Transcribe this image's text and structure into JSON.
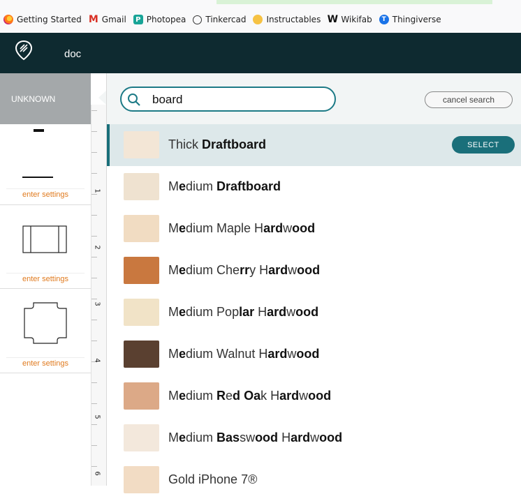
{
  "bookmarks": [
    {
      "label": "Getting Started",
      "icon": "firefox-icon"
    },
    {
      "label": "Gmail",
      "icon": "gmail-icon",
      "glyph": "M"
    },
    {
      "label": "Photopea",
      "icon": "photopea-icon",
      "glyph": "P"
    },
    {
      "label": "Tinkercad",
      "icon": "tinkercad-icon",
      "glyph": ""
    },
    {
      "label": "Instructables",
      "icon": "instructables-icon",
      "glyph": ""
    },
    {
      "label": "Wikifab",
      "icon": "wikifab-icon",
      "glyph": "W"
    },
    {
      "label": "Thingiverse",
      "icon": "thingiverse-icon",
      "glyph": "T"
    }
  ],
  "header": {
    "doc_title": "doc",
    "logo_icon": "glowforge-logo-icon",
    "bg_color": "#0e2a30"
  },
  "left_panel": {
    "material_tab": "UNKNOWN",
    "shapes": [
      {
        "name": "line-shape",
        "settings_label": "enter settings"
      },
      {
        "name": "rectangle-shape",
        "settings_label": "enter settings"
      },
      {
        "name": "rounded-shape",
        "settings_label": "enter settings"
      }
    ]
  },
  "ruler": {
    "numbers": [
      "1",
      "2",
      "3",
      "4",
      "5",
      "6"
    ]
  },
  "search": {
    "query": "board",
    "cancel_label": "cancel search",
    "accent": "#1a6f7a"
  },
  "results": [
    {
      "parts": [
        [
          "Thick ",
          false
        ],
        [
          "Draft",
          true
        ],
        [
          "board",
          true
        ]
      ],
      "color": "#f3e6d6",
      "selected": true
    },
    {
      "parts": [
        [
          "M",
          false
        ],
        [
          "e",
          true
        ],
        [
          "dium ",
          false
        ],
        [
          "Draft",
          true
        ],
        [
          "board",
          true
        ]
      ],
      "color": "#efe2d0",
      "selected": false
    },
    {
      "parts": [
        [
          "M",
          false
        ],
        [
          "e",
          true
        ],
        [
          "dium Maple H",
          false
        ],
        [
          "ard",
          true
        ],
        [
          "w",
          false
        ],
        [
          "ood",
          true
        ]
      ],
      "color": "#f1dcc2",
      "selected": false
    },
    {
      "parts": [
        [
          "M",
          false
        ],
        [
          "e",
          true
        ],
        [
          "dium Che",
          false
        ],
        [
          "rr",
          true
        ],
        [
          "y H",
          false
        ],
        [
          "ard",
          true
        ],
        [
          "w",
          false
        ],
        [
          "ood",
          true
        ]
      ],
      "color": "#c9783f",
      "selected": false
    },
    {
      "parts": [
        [
          "M",
          false
        ],
        [
          "e",
          true
        ],
        [
          "dium Po",
          false
        ],
        [
          "p",
          false
        ],
        [
          "lar",
          true
        ],
        [
          " H",
          false
        ],
        [
          "ard",
          true
        ],
        [
          "w",
          false
        ],
        [
          "ood",
          true
        ]
      ],
      "color": "#f1e3c7",
      "selected": false
    },
    {
      "parts": [
        [
          "M",
          false
        ],
        [
          "e",
          true
        ],
        [
          "dium Walnut H",
          false
        ],
        [
          "ard",
          true
        ],
        [
          "w",
          false
        ],
        [
          "ood",
          true
        ]
      ],
      "color": "#5a4030",
      "selected": false
    },
    {
      "parts": [
        [
          "M",
          false
        ],
        [
          "e",
          true
        ],
        [
          "dium ",
          false
        ],
        [
          "R",
          true
        ],
        [
          "e",
          false
        ],
        [
          "d",
          true
        ],
        [
          " ",
          false
        ],
        [
          "Oa",
          true
        ],
        [
          "k H",
          false
        ],
        [
          "ard",
          true
        ],
        [
          "w",
          false
        ],
        [
          "ood",
          true
        ]
      ],
      "color": "#dca987",
      "selected": false
    },
    {
      "parts": [
        [
          "M",
          false
        ],
        [
          "e",
          true
        ],
        [
          "dium ",
          false
        ],
        [
          "Bas",
          true
        ],
        [
          "sw",
          false
        ],
        [
          "ood",
          true
        ],
        [
          " H",
          false
        ],
        [
          "ard",
          true
        ],
        [
          "w",
          false
        ],
        [
          "ood",
          true
        ]
      ],
      "color": "#f3e8dc",
      "selected": false
    },
    {
      "parts": [
        [
          "Gold iPhone 7®",
          false
        ]
      ],
      "color": "#f2dcc4",
      "selected": false
    }
  ],
  "select_label": "SELECT"
}
